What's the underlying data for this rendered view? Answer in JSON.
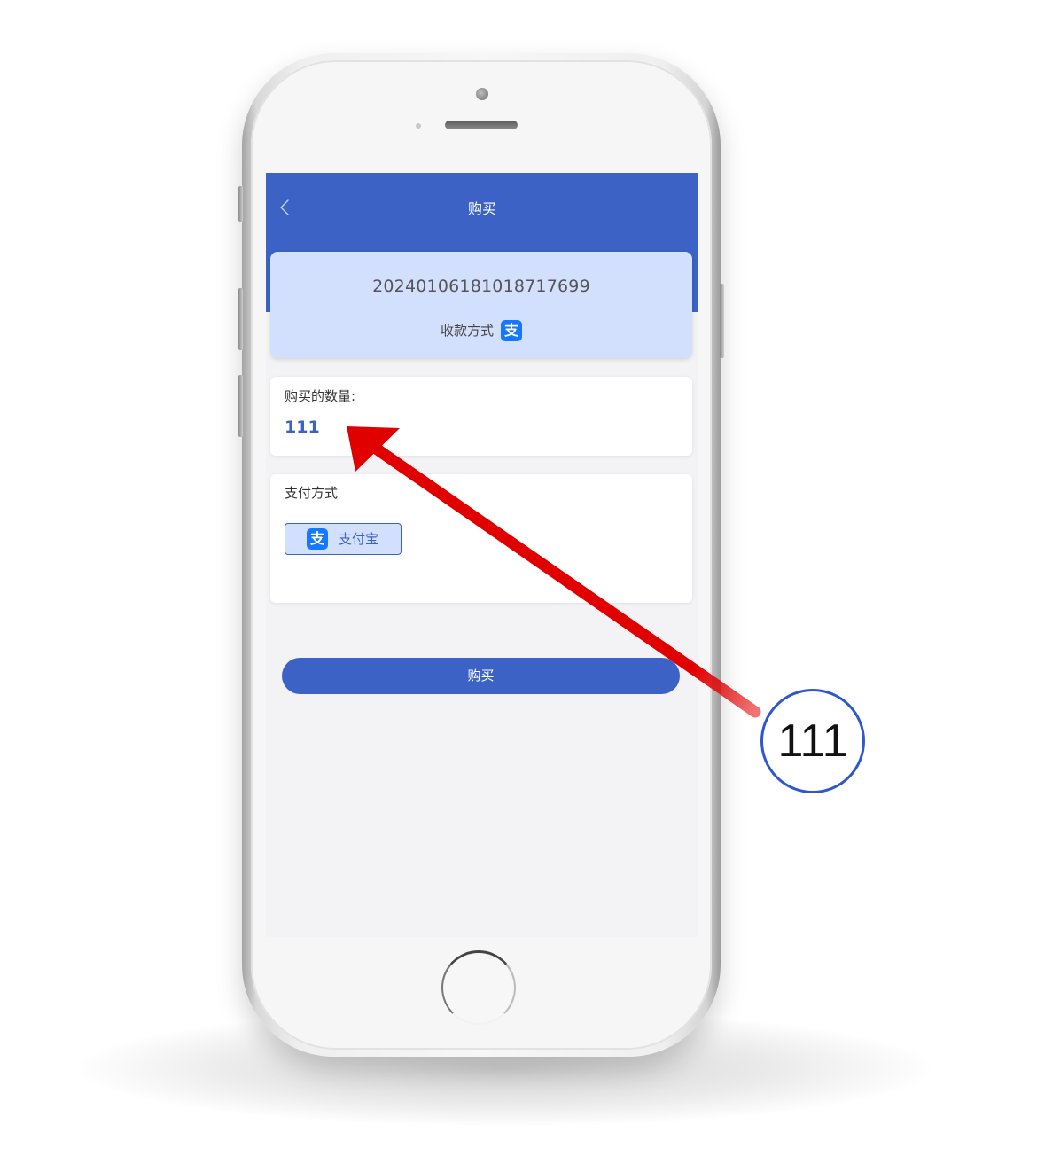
{
  "screen": {
    "header": {
      "title": "购买",
      "back_icon": "chevron-left-icon"
    },
    "order_card": {
      "order_number": "20240106181018717699",
      "collection_label": "收款方式",
      "collection_icon": "alipay-icon",
      "collection_icon_glyph": "支"
    },
    "quantity_card": {
      "label": "购买的数量:",
      "value": "111"
    },
    "payment_card": {
      "label": "支付方式",
      "selected_option": {
        "icon": "alipay-icon",
        "icon_glyph": "支",
        "label": "支付宝"
      }
    },
    "buy_button_label": "购买"
  },
  "annotation": {
    "callout_text": "111",
    "arrow_color": "#e10000",
    "circle_color": "#2f58cf"
  },
  "colors": {
    "brand_blue": "#3b62c4",
    "card_light_blue": "#d3e0fd",
    "alipay_blue": "#1677ff",
    "screen_background": "#f3f3f5"
  }
}
